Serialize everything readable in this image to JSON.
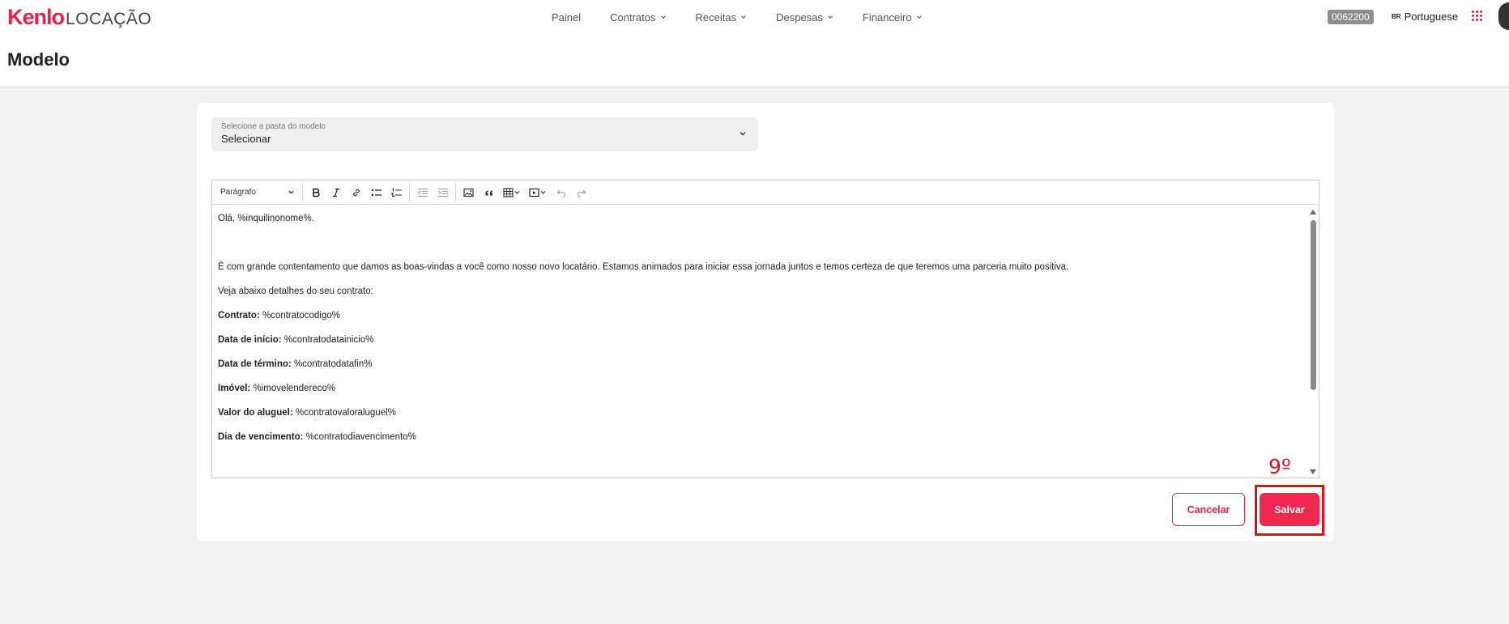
{
  "header": {
    "logo_main": "Kenlo",
    "logo_sub": "LOCAÇÃO",
    "nav": [
      {
        "label": "Painel",
        "dropdown": false
      },
      {
        "label": "Contratos",
        "dropdown": true
      },
      {
        "label": "Receitas",
        "dropdown": true
      },
      {
        "label": "Despesas",
        "dropdown": true
      },
      {
        "label": "Financeiro",
        "dropdown": true
      }
    ],
    "account_code": "0062200",
    "language_flag": "BR",
    "language": "Portuguese",
    "apps_icon": "apps-grid-icon"
  },
  "page": {
    "title": "Modelo"
  },
  "folder_select": {
    "label": "Selecione a pasta do modelo",
    "value": "Selecionar"
  },
  "editor": {
    "paragraph_style": "Parágrafo",
    "toolbar_icons": [
      "bold-icon",
      "italic-icon",
      "link-icon",
      "bulleted-list-icon",
      "numbered-list-icon",
      "outdent-icon",
      "indent-icon",
      "image-icon",
      "blockquote-icon",
      "table-icon",
      "media-embed-icon",
      "undo-icon",
      "redo-icon"
    ],
    "lines": [
      {
        "bold": "",
        "text": "Olá, %inquilinonome%."
      },
      {
        "bold": "",
        "text": ""
      },
      {
        "bold": "",
        "text": "É com grande contentamento que damos as boas-vindas a você como nosso novo locatário. Estamos animados para iniciar essa jornada juntos e temos certeza de que teremos uma parceria muito positiva."
      },
      {
        "bold": "",
        "text": "Veja abaixo detalhes do seu contrato:"
      },
      {
        "bold": "Contrato:",
        "text": " %contratocodigo%"
      },
      {
        "bold": "Data de início:",
        "text": " %contratodatainicio%"
      },
      {
        "bold": "Data de término:",
        "text": " %contratodatafin%"
      },
      {
        "bold": "Imóvel:",
        "text": " %imovelendereco%"
      },
      {
        "bold": "Valor do aluguel:",
        "text": " %contratovaloraluguel%"
      },
      {
        "bold": "Dia de vencimento:",
        "text": " %contratodiavencimento%"
      }
    ]
  },
  "actions": {
    "cancel_label": "Cancelar",
    "save_label": "Salvar"
  },
  "annotation": {
    "step_label": "9º",
    "color": "#e01018"
  },
  "colors": {
    "brand": "#e6224a",
    "save_button": "#f0284e",
    "page_bg": "#f1f1f1"
  }
}
